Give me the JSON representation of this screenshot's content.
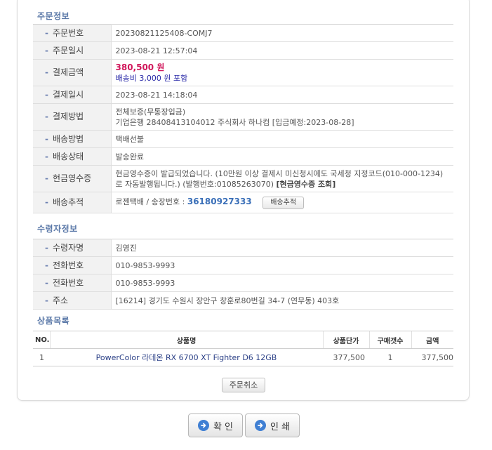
{
  "order_section": {
    "title": "주문정보",
    "rows": [
      {
        "label": "주문번호",
        "value": "20230821125408-COMJ7"
      },
      {
        "label": "주문일시",
        "value": "2023-08-21 12:57:04"
      },
      {
        "label": "결제금액",
        "amount": "380,500 원",
        "note": "배송비 3,000 원 포함"
      },
      {
        "label": "결제일시",
        "value": "2023-08-21 14:18:04"
      },
      {
        "label": "결제방법",
        "line1": "전체보증(무통장입금)",
        "line2": "기업은행 28408413104012 주식회사 하나컴 [입금예정:2023-08-28]"
      },
      {
        "label": "배송방법",
        "value": "택배선불"
      },
      {
        "label": "배송상태",
        "value": "발송완료"
      },
      {
        "label": "현금영수증",
        "value": "현금영수증이 발급되었습니다. (10만원 이상 결제시 미신청시에도 국세청 지정코드(010-000-1234)로 자동발행됩니다.) (발행번호:01085263070)",
        "link": "[현금영수증 조회]"
      },
      {
        "label": "배송추적",
        "prefix": "로젠택배 / 송장번호 : ",
        "tracking_number": "36180927333",
        "button": "배송추적"
      }
    ]
  },
  "receiver_section": {
    "title": "수령자정보",
    "rows": [
      {
        "label": "수령자명",
        "value": "김영진"
      },
      {
        "label": "전화번호",
        "value": "010-9853-9993"
      },
      {
        "label": "전화번호",
        "value": "010-9853-9993"
      },
      {
        "label": "주소",
        "value": "[16214] 경기도 수원시 장안구 창훈로80번길 34-7 (연무동) 403호"
      }
    ]
  },
  "products_section": {
    "title": "상품목록",
    "headers": [
      "NO.",
      "상품명",
      "상품단가",
      "구매갯수",
      "금액"
    ],
    "rows": [
      {
        "no": "1",
        "name": "PowerColor 라데온 RX 6700 XT Fighter D6 12GB",
        "price": "377,500",
        "qty": "1",
        "total": "377,500"
      }
    ]
  },
  "cancel_button": "주문취소",
  "confirm_button": "확 인",
  "print_button": "인 쇄",
  "colors": {
    "section_title": "#5a78a8",
    "amount": "#d0165a",
    "shipping_note": "#2a2aa8",
    "tracking_number": "#3a6fb8",
    "product_name": "#2a3f86",
    "product_total": "#d86b1a",
    "button_icon": "#3f7fd3"
  },
  "icons": {
    "confirm": "arrow-circle-right-icon",
    "print": "arrow-circle-right-icon"
  }
}
